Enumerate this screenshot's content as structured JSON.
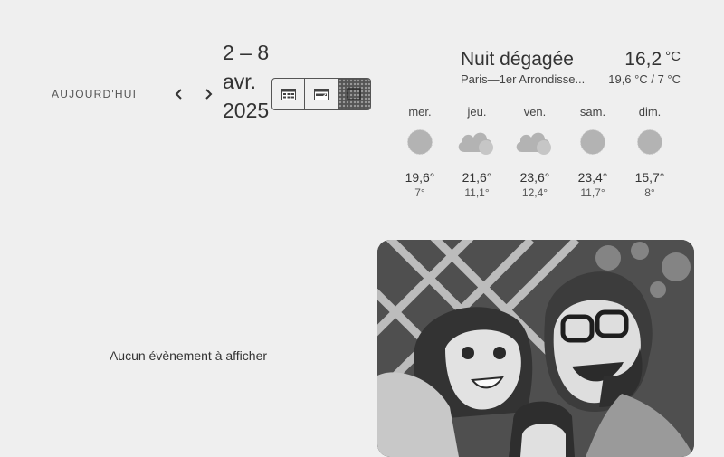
{
  "toolbar": {
    "today_label": "AUJOURD'HUI",
    "prev_icon": "chevron-left-icon",
    "next_icon": "chevron-right-icon",
    "date_range": "2 – 8 avr. 2025",
    "views": [
      {
        "icon": "month-grid-icon",
        "active": false
      },
      {
        "icon": "week-list-icon",
        "active": false
      },
      {
        "icon": "photo-view-icon",
        "active": true
      }
    ]
  },
  "weather": {
    "condition": "Nuit dégagée",
    "temperature": "16,2",
    "unit": "°C",
    "location": "Paris—1er Arrondisse...",
    "range": "19,6 °C / 7 °C"
  },
  "forecast": [
    {
      "day": "mer.",
      "icon": "clear-icon",
      "high": "19,6°",
      "low": "7°"
    },
    {
      "day": "jeu.",
      "icon": "partly-cloudy-icon",
      "high": "21,6°",
      "low": "11,1°"
    },
    {
      "day": "ven.",
      "icon": "partly-cloudy-icon",
      "high": "23,6°",
      "low": "12,4°"
    },
    {
      "day": "sam.",
      "icon": "clear-icon",
      "high": "23,4°",
      "low": "11,7°"
    },
    {
      "day": "dim.",
      "icon": "clear-icon",
      "high": "15,7°",
      "low": "8°"
    }
  ],
  "events": {
    "empty_text": "Aucun évènement à afficher"
  },
  "photo": {
    "description_icon": "family-photo"
  }
}
